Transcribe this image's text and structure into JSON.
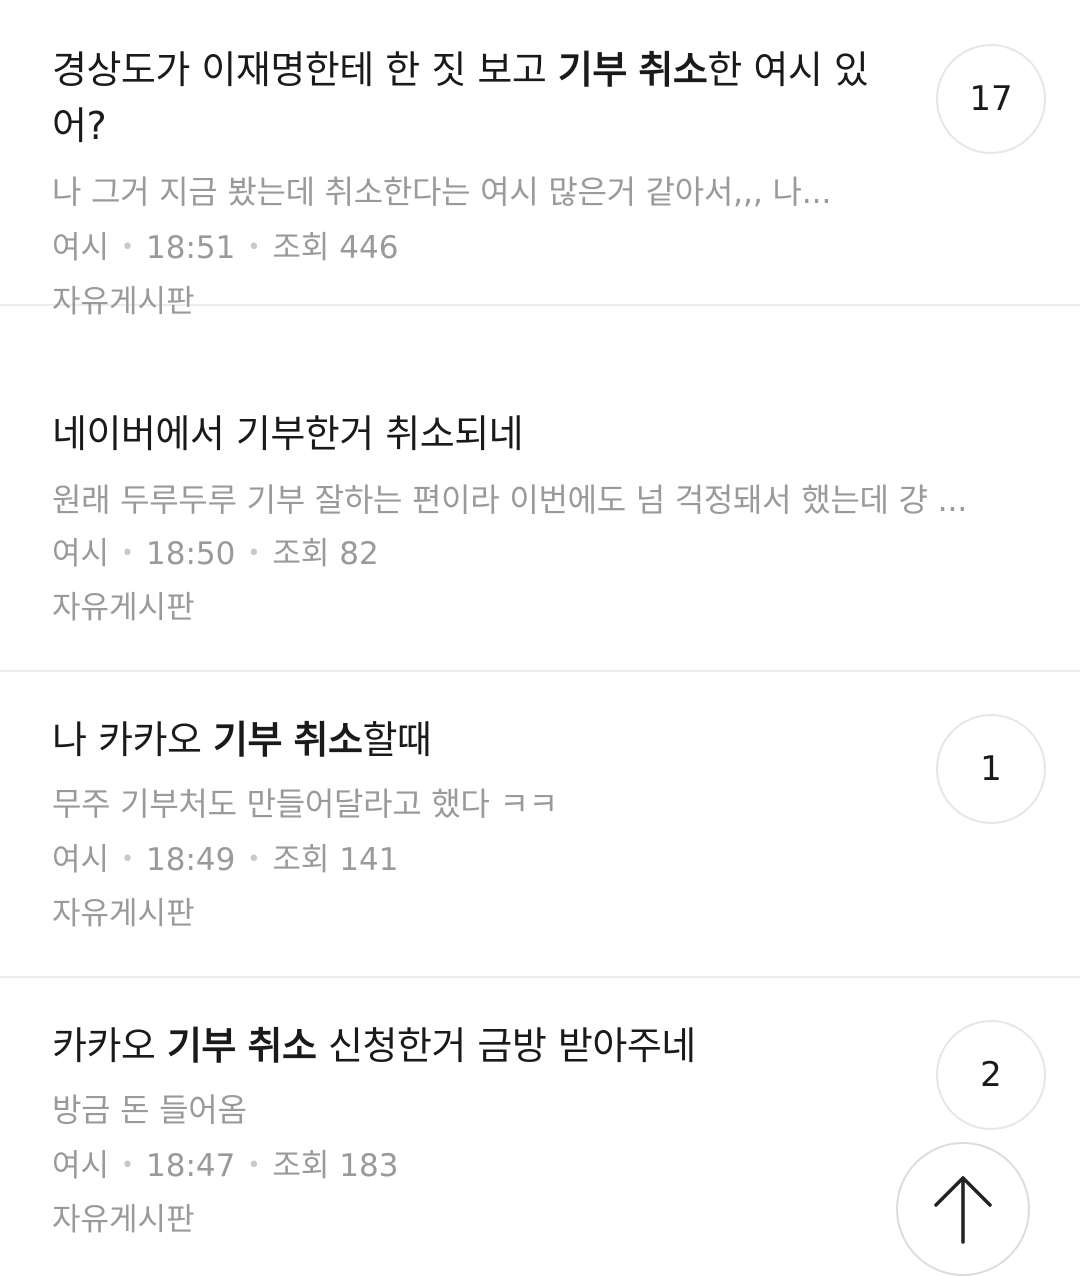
{
  "posts": [
    {
      "title": {
        "pre": "경상도가 이재명한테 한 짓 보고 ",
        "bold1": "기부",
        "mid": " ",
        "bold2": "취소",
        "post": "한 여시 있어?"
      },
      "preview": "나 그거 지금 봤는데 취소한다는 여시 많은거 같아서,,, 나...",
      "author": "여시",
      "time": "18:51",
      "views": "조회 446",
      "board": "자유게시판",
      "comments": "17"
    },
    {
      "title": {
        "pre": "네이버에서 기부한거 취소되네",
        "bold1": "",
        "mid": "",
        "bold2": "",
        "post": ""
      },
      "preview": "원래 두루두루 기부 잘하는 편이라 이번에도 넘 걱정돼서 했는데 걍 ...",
      "author": "여시",
      "time": "18:50",
      "views": "조회 82",
      "board": "자유게시판",
      "comments": ""
    },
    {
      "title": {
        "pre": "나 카카오 ",
        "bold1": "기부",
        "mid": " ",
        "bold2": "취소",
        "post": "할때"
      },
      "preview": "무주 기부처도 만들어달라고 했다 ㅋㅋ",
      "author": "여시",
      "time": "18:49",
      "views": "조회 141",
      "board": "자유게시판",
      "comments": "1"
    },
    {
      "title": {
        "pre": "카카오 ",
        "bold1": "기부",
        "mid": " ",
        "bold2": "취소",
        "post": " 신청한거 금방 받아주네"
      },
      "preview": "방금 돈 들어옴",
      "author": "여시",
      "time": "18:47",
      "views": "조회 183",
      "board": "자유게시판",
      "comments": "2"
    }
  ],
  "meta_separator": "•",
  "icons": {
    "scroll_top": "arrow-up-icon"
  }
}
